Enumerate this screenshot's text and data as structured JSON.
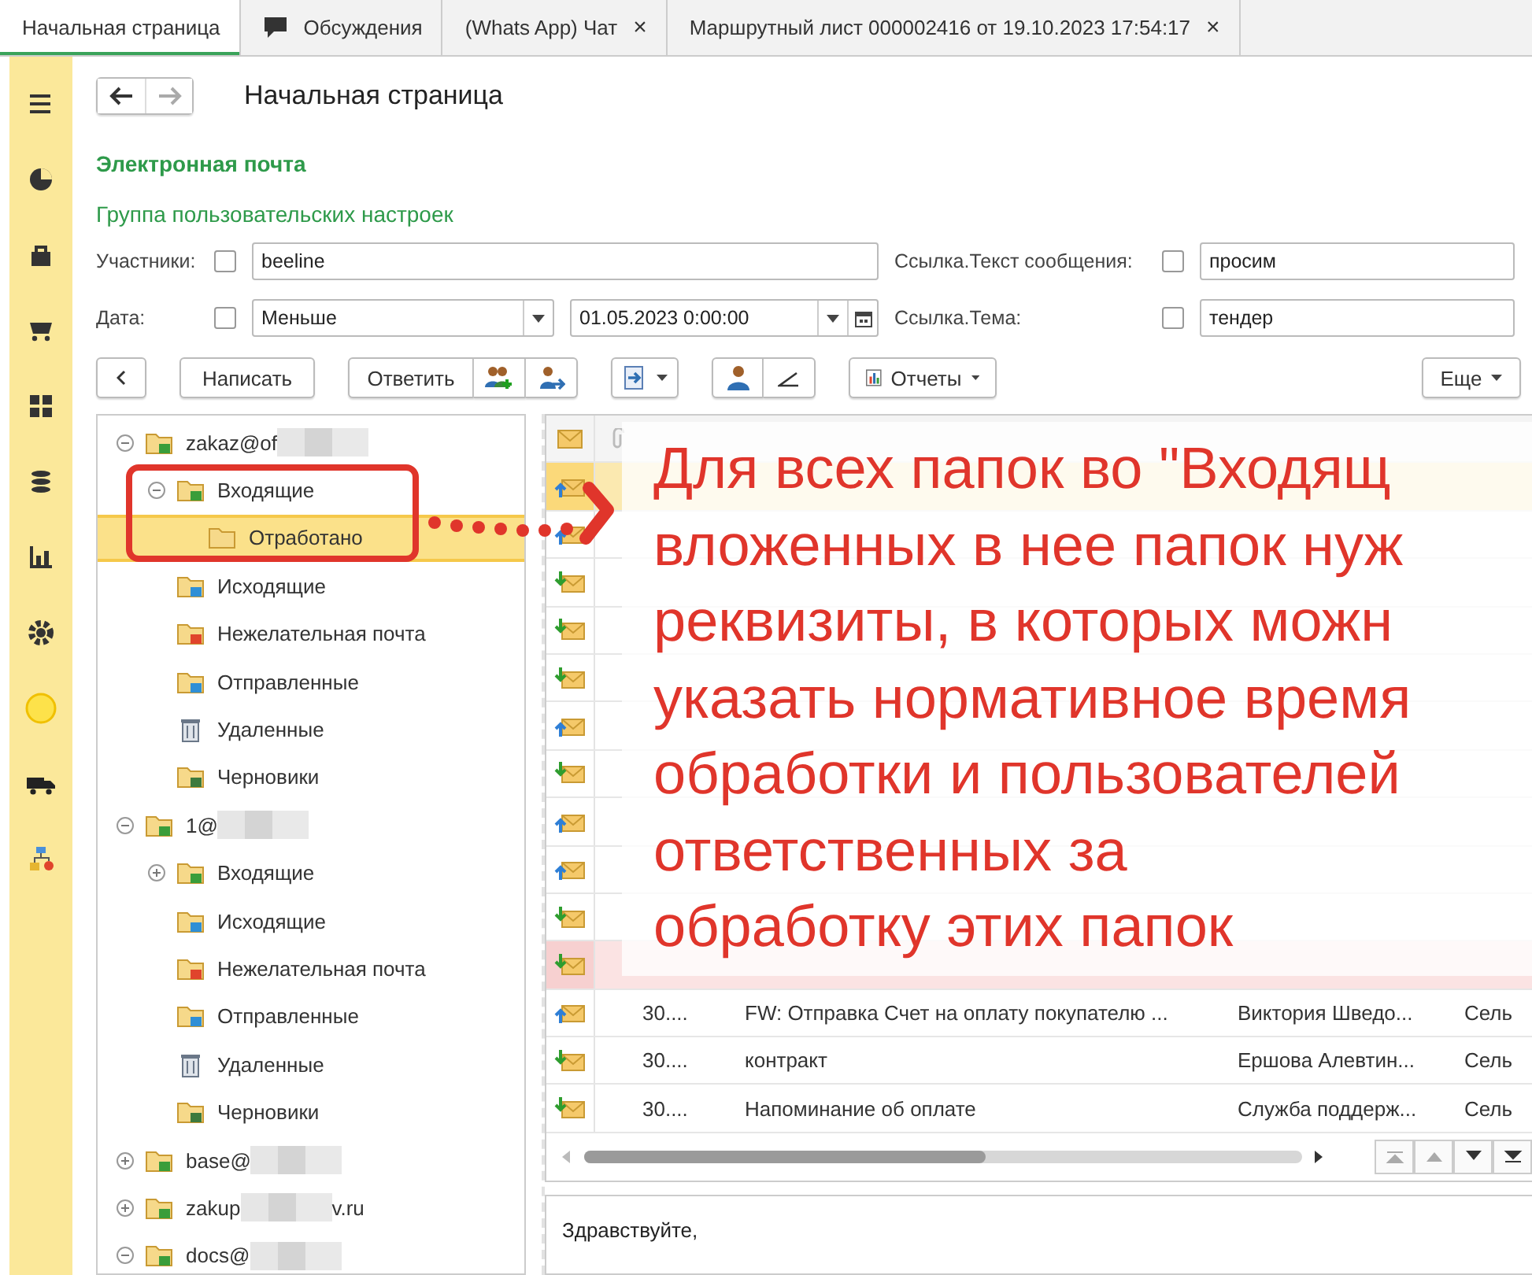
{
  "tabs": [
    {
      "label": "Начальная страница",
      "kind": "plain",
      "selected": true
    },
    {
      "label": "Обсуждения",
      "kind": "chat",
      "selected": false
    },
    {
      "label": "(Whats App) Чат",
      "kind": "plain",
      "close": "×",
      "selected": false
    },
    {
      "label": "Маршрутный лист 000002416 от 19.10.2023 17:54:17",
      "kind": "plain",
      "close": "×",
      "selected": false
    }
  ],
  "page_title": "Начальная страница",
  "section_title": "Электронная почта",
  "group_title": "Группа пользовательских настроек",
  "filters": [
    [
      {
        "kind": "label",
        "text": "Участники:"
      },
      {
        "kind": "check",
        "checked": false
      },
      {
        "kind": "input",
        "value": "beeline"
      },
      {
        "kind": "label",
        "text": "Ссылка.Текст сообщения:"
      },
      {
        "kind": "check",
        "checked": false
      },
      {
        "kind": "input",
        "value": "просим"
      }
    ],
    [
      {
        "kind": "label",
        "text": "Дата:"
      },
      {
        "kind": "check",
        "checked": false
      },
      {
        "kind": "select",
        "value": "Меньше"
      },
      {
        "kind": "date",
        "value": "01.05.2023  0:00:00"
      },
      {
        "kind": "label",
        "text": "Ссылка.Тема:"
      },
      {
        "kind": "check",
        "checked": false
      },
      {
        "kind": "input",
        "value": "тендер"
      }
    ]
  ],
  "toolbar": {
    "write": "Написать",
    "reply": "Ответить",
    "reports": "Отчеты",
    "more": "Еще"
  },
  "tree": [
    {
      "label": "zakaz@of",
      "kind": "account",
      "redacted": true,
      "expanded": true,
      "selected": false,
      "children": [
        {
          "label": "Входящие",
          "kind": "inbox",
          "expanded": true,
          "selected": false,
          "children": [
            {
              "label": "Отработано",
              "kind": "folder",
              "selected": true
            }
          ]
        },
        {
          "label": "Исходящие",
          "kind": "outbox",
          "selected": false
        },
        {
          "label": "Нежелательная почта",
          "kind": "spam",
          "selected": false
        },
        {
          "label": "Отправленные",
          "kind": "sent",
          "selected": false
        },
        {
          "label": "Удаленные",
          "kind": "trash",
          "selected": false
        },
        {
          "label": "Черновики",
          "kind": "drafts",
          "selected": false
        }
      ]
    },
    {
      "label": "1@",
      "kind": "account",
      "redacted": true,
      "expanded": true,
      "selected": false,
      "children": [
        {
          "label": "Входящие",
          "kind": "inbox",
          "expanded": false,
          "selected": false
        },
        {
          "label": "Исходящие",
          "kind": "outbox",
          "selected": false
        },
        {
          "label": "Нежелательная почта",
          "kind": "spam",
          "selected": false
        },
        {
          "label": "Отправленные",
          "kind": "sent",
          "selected": false
        },
        {
          "label": "Удаленные",
          "kind": "trash",
          "selected": false
        },
        {
          "label": "Черновики",
          "kind": "drafts",
          "selected": false
        }
      ]
    },
    {
      "label": "base@",
      "kind": "account",
      "redacted": true,
      "expanded": false,
      "selected": false
    },
    {
      "label": "zakup",
      "label_tail": "v.ru",
      "kind": "account",
      "redacted": true,
      "expanded": false,
      "selected": false
    },
    {
      "label": "docs@",
      "kind": "account",
      "redacted": true,
      "expanded": true,
      "selected": false
    }
  ],
  "table": {
    "rows": [
      {
        "kind": "out",
        "selected": true,
        "highlighted": false
      },
      {
        "kind": "out",
        "selected": false,
        "highlighted": false
      },
      {
        "kind": "in",
        "selected": false,
        "highlighted": false
      },
      {
        "kind": "in",
        "selected": false,
        "highlighted": false
      },
      {
        "kind": "in",
        "selected": false,
        "highlighted": false
      },
      {
        "kind": "out",
        "selected": false,
        "highlighted": false
      },
      {
        "kind": "in",
        "selected": false,
        "highlighted": false
      },
      {
        "kind": "out",
        "selected": false,
        "highlighted": false
      },
      {
        "kind": "out",
        "selected": false,
        "highlighted": false
      },
      {
        "kind": "in",
        "selected": false,
        "highlighted": false
      },
      {
        "kind": "in",
        "selected": false,
        "highlighted": true
      },
      {
        "kind": "out",
        "selected": false,
        "highlighted": false,
        "date": "30....",
        "subject": "FW: Отправка Счет на оплату покупателю ...",
        "participants": "Виктория Шведо...",
        "answer": "Сель"
      },
      {
        "kind": "in",
        "selected": false,
        "highlighted": false,
        "date": "30....",
        "subject": "контракт",
        "participants": "Ершова Алевтин...",
        "answer": "Сель"
      },
      {
        "kind": "in",
        "selected": false,
        "highlighted": false,
        "date": "30....",
        "subject": "Напоминание об оплате",
        "participants": "Служба поддерж...",
        "answer": "Сель"
      }
    ]
  },
  "preview": {
    "greeting": "Здравствуйте,"
  },
  "annotation": {
    "lines": [
      "Для всех папок во \"Входящ",
      "вложенных в нее папок нуж",
      "реквизиты, в которых можн",
      "указать нормативное время",
      "обработки и пользователей",
      "ответственных за",
      "обработку этих папок"
    ]
  }
}
